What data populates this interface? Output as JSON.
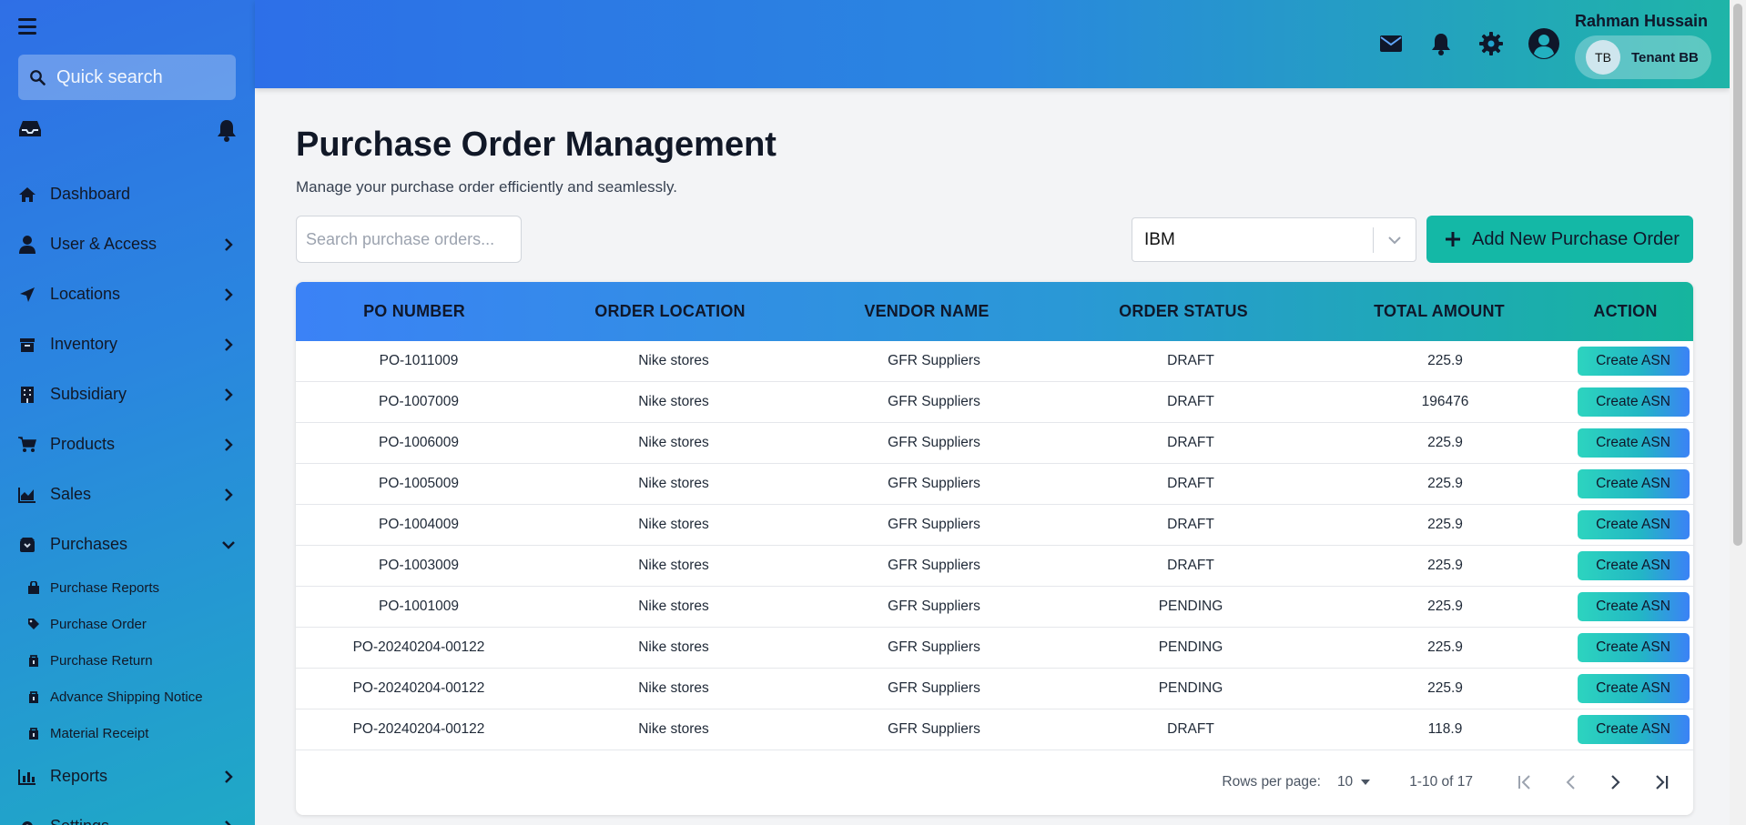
{
  "sidebar": {
    "search_placeholder": "Quick search",
    "menu_icon": "hamburger-icon",
    "items": [
      {
        "label": "Dashboard",
        "icon": "home-icon",
        "expandable": false
      },
      {
        "label": "User & Access",
        "icon": "user-icon",
        "expandable": true
      },
      {
        "label": "Locations",
        "icon": "location-arrow-icon",
        "expandable": true
      },
      {
        "label": "Inventory",
        "icon": "archive-icon",
        "expandable": true
      },
      {
        "label": "Subsidiary",
        "icon": "building-icon",
        "expandable": true
      },
      {
        "label": "Products",
        "icon": "cart-icon",
        "expandable": true
      },
      {
        "label": "Sales",
        "icon": "area-chart-icon",
        "expandable": true
      },
      {
        "label": "Purchases",
        "icon": "box-icon",
        "expandable": true,
        "expanded": true
      }
    ],
    "sub_items": [
      {
        "label": "Purchase Reports",
        "icon": "bag-icon"
      },
      {
        "label": "Purchase Order",
        "icon": "tag-icon"
      },
      {
        "label": "Purchase Return",
        "icon": "lock-box-icon"
      },
      {
        "label": "Advance Shipping Notice",
        "icon": "lock-box-icon"
      },
      {
        "label": "Material Receipt",
        "icon": "lock-box-icon"
      }
    ],
    "after_items": [
      {
        "label": "Reports",
        "icon": "bar-chart-icon"
      },
      {
        "label": "Settings",
        "icon": "gear-icon"
      }
    ]
  },
  "header": {
    "user_name": "Rahman Hussain",
    "tenant_initials": "TB",
    "tenant_name": "Tenant BB"
  },
  "main": {
    "title": "Purchase Order Management",
    "subtitle": "Manage your purchase order efficiently and seamlessly.",
    "search_placeholder": "Search purchase orders...",
    "vendor_selected": "IBM",
    "add_button": "Add New Purchase Order"
  },
  "table": {
    "headers": [
      "PO NUMBER",
      "ORDER LOCATION",
      "VENDOR NAME",
      "ORDER STATUS",
      "TOTAL AMOUNT",
      "ACTION"
    ],
    "action_label": "Create ASN",
    "rows": [
      [
        "PO-1011009",
        "Nike stores",
        "GFR Suppliers",
        "DRAFT",
        "225.9"
      ],
      [
        "PO-1007009",
        "Nike stores",
        "GFR Suppliers",
        "DRAFT",
        "196476"
      ],
      [
        "PO-1006009",
        "Nike stores",
        "GFR Suppliers",
        "DRAFT",
        "225.9"
      ],
      [
        "PO-1005009",
        "Nike stores",
        "GFR Suppliers",
        "DRAFT",
        "225.9"
      ],
      [
        "PO-1004009",
        "Nike stores",
        "GFR Suppliers",
        "DRAFT",
        "225.9"
      ],
      [
        "PO-1003009",
        "Nike stores",
        "GFR Suppliers",
        "DRAFT",
        "225.9"
      ],
      [
        "PO-1001009",
        "Nike stores",
        "GFR Suppliers",
        "PENDING",
        "225.9"
      ],
      [
        "PO-20240204-00122",
        "Nike stores",
        "GFR Suppliers",
        "PENDING",
        "225.9"
      ],
      [
        "PO-20240204-00122",
        "Nike stores",
        "GFR Suppliers",
        "PENDING",
        "225.9"
      ],
      [
        "PO-20240204-00122",
        "Nike stores",
        "GFR Suppliers",
        "DRAFT",
        "118.9"
      ]
    ]
  },
  "pagination": {
    "rows_per_page_label": "Rows per page:",
    "rows_per_page": "10",
    "range": "1-10 of 17"
  },
  "colors": {
    "accent_teal": "#14b8a6",
    "header_blue": "#2d6fe8"
  }
}
